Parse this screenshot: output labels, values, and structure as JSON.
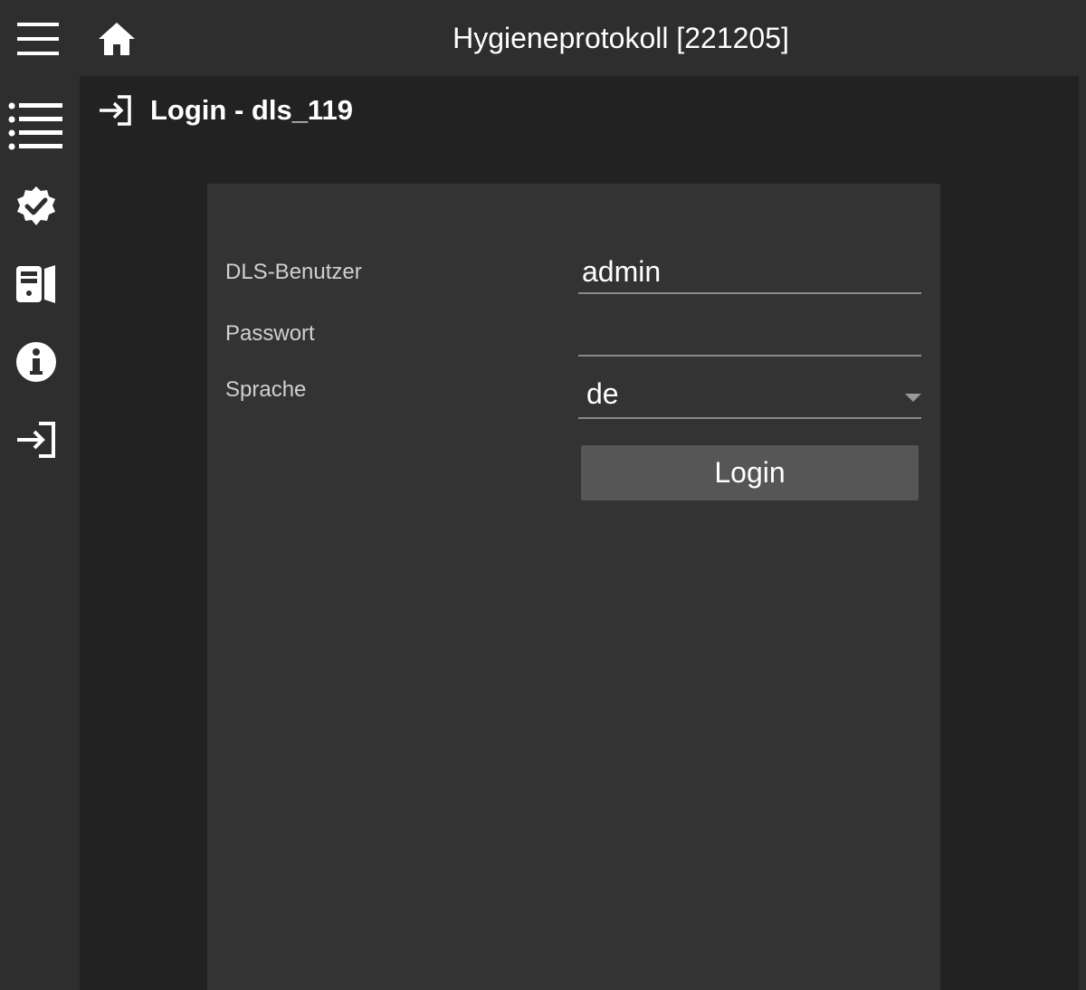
{
  "topbar": {
    "title": "Hygieneprotokoll [221205]",
    "menu_icon": "hamburger-menu-icon",
    "home_icon": "home-icon"
  },
  "sidebar": {
    "items": [
      {
        "icon": "list-icon",
        "name": "list"
      },
      {
        "icon": "verified-check-badge-icon",
        "name": "verification"
      },
      {
        "icon": "device-panel-icon",
        "name": "devices"
      },
      {
        "icon": "info-icon",
        "name": "info"
      },
      {
        "icon": "login-arrow-icon",
        "name": "login"
      }
    ]
  },
  "page": {
    "title": "Login - dls_119",
    "title_icon": "login-arrow-icon"
  },
  "form": {
    "user_label": "DLS-Benutzer",
    "user_value": "admin",
    "password_label": "Passwort",
    "password_value": "",
    "language_label": "Sprache",
    "language_value": "de",
    "login_button": "Login"
  },
  "colors": {
    "background": "#2e2e2e",
    "main": "#222222",
    "card": "#333333",
    "button": "#565656",
    "text": "#ffffff",
    "label": "#d0d0d0"
  }
}
